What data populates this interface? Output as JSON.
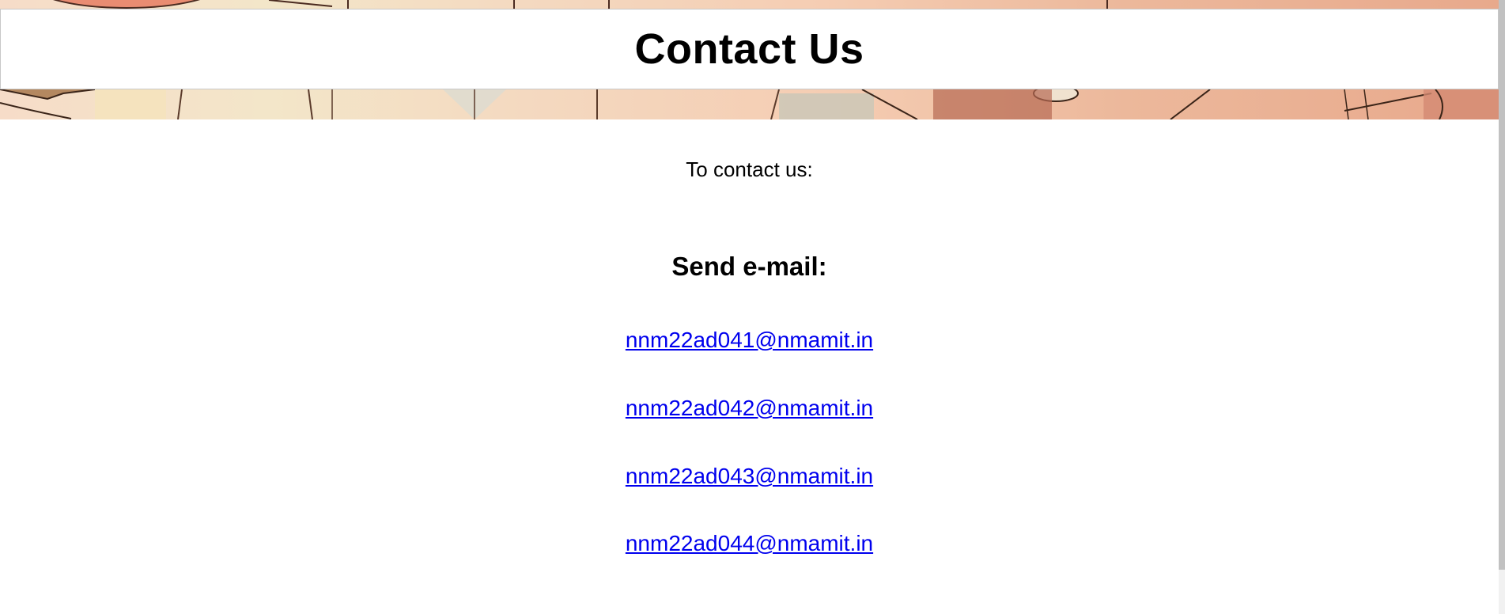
{
  "header": {
    "title": "Contact Us"
  },
  "main": {
    "intro_text": "To contact us:",
    "email_heading": "Send e-mail:",
    "emails": [
      {
        "label": "nnm22ad041@nmamit.in",
        "href": "mailto:nnm22ad041@nmamit.in"
      },
      {
        "label": "nnm22ad042@nmamit.in",
        "href": "mailto:nnm22ad042@nmamit.in"
      },
      {
        "label": "nnm22ad043@nmamit.in",
        "href": "mailto:nnm22ad043@nmamit.in"
      },
      {
        "label": "nnm22ad044@nmamit.in",
        "href": "mailto:nnm22ad044@nmamit.in"
      }
    ]
  },
  "colors": {
    "link": "#0000ee",
    "text": "#000000",
    "background": "#ffffff"
  }
}
